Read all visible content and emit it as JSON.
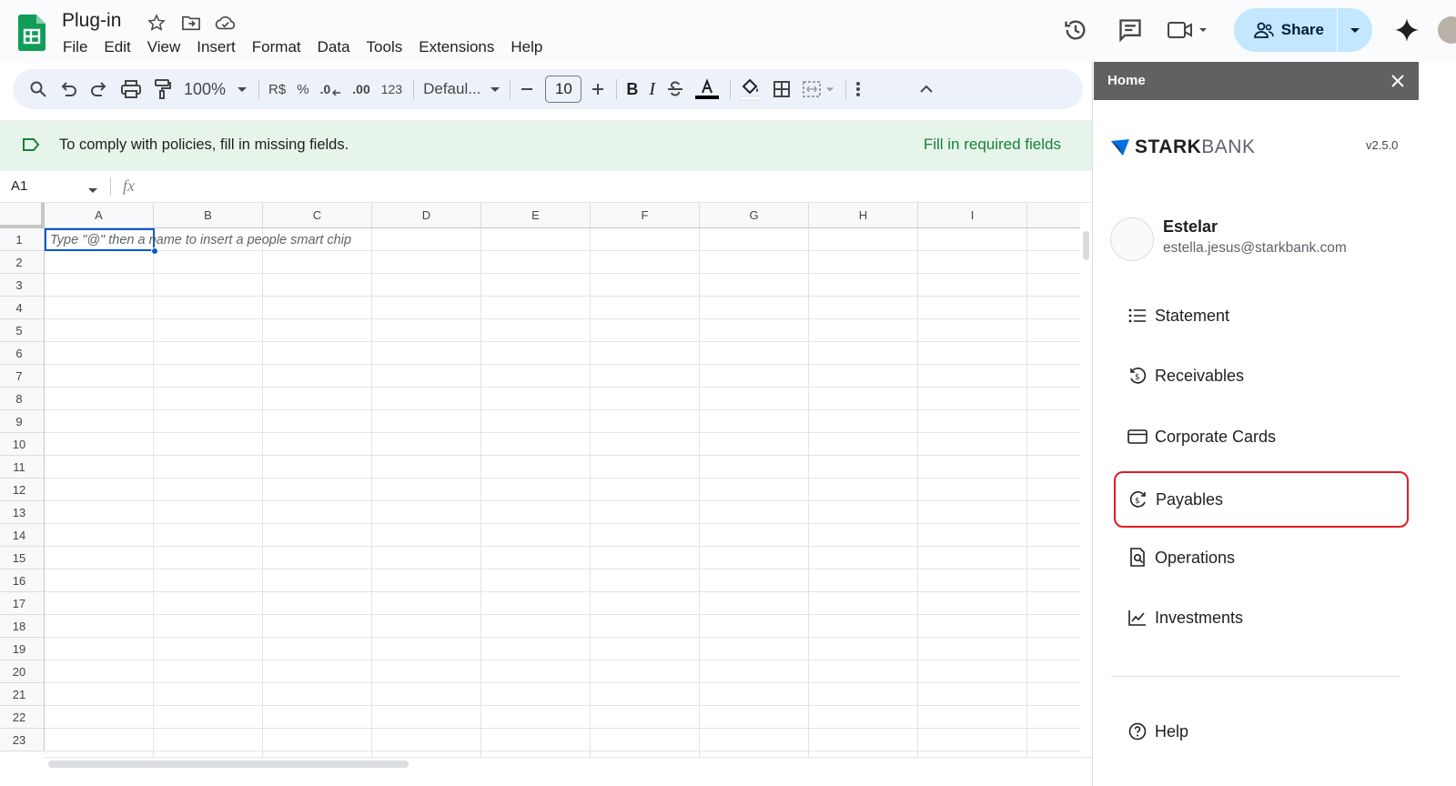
{
  "app": {
    "doc_title": "Plug-in",
    "menu": [
      "File",
      "Edit",
      "View",
      "Insert",
      "Format",
      "Data",
      "Tools",
      "Extensions",
      "Help"
    ],
    "share_label": "Share"
  },
  "toolbar": {
    "zoom": "100%",
    "currency": "R$",
    "percent": "%",
    "decrease_decimal": ".0",
    "increase_decimal": ".00",
    "number_format": "123",
    "font": "Defaul...",
    "font_size": "10",
    "bold": "B",
    "italic": "I"
  },
  "banner": {
    "message": "To comply with policies, fill in missing fields.",
    "action": "Fill in required fields"
  },
  "formula_bar": {
    "cell_ref": "A1",
    "fx": "fx"
  },
  "sheet": {
    "columns": [
      "A",
      "B",
      "C",
      "D",
      "E",
      "F",
      "G",
      "H",
      "I"
    ],
    "rows": [
      "1",
      "2",
      "3",
      "4",
      "5",
      "6",
      "7",
      "8",
      "9",
      "10",
      "11",
      "12",
      "13",
      "14",
      "15",
      "16",
      "17",
      "18",
      "19",
      "20",
      "21",
      "22",
      "23"
    ],
    "cell_hint": "Type \"@\" then a name to insert a people smart chip"
  },
  "panel": {
    "title": "Home",
    "brand_bold": "STARK",
    "brand_light": "BANK",
    "version": "v2.5.0",
    "user_name": "Estelar",
    "user_email": "estella.jesus@starkbank.com",
    "nav": [
      {
        "label": "Statement",
        "icon": "list-icon"
      },
      {
        "label": "Receivables",
        "icon": "receivable-coin-icon"
      },
      {
        "label": "Corporate Cards",
        "icon": "credit-card-icon"
      },
      {
        "label": "Payables",
        "icon": "payable-coin-icon"
      },
      {
        "label": "Operations",
        "icon": "document-search-icon"
      },
      {
        "label": "Investments",
        "icon": "trend-chart-icon"
      }
    ],
    "help_label": "Help",
    "highlight_color": "#e31b23"
  },
  "colors": {
    "brand_green": "#0f9d58",
    "share_bg": "#c2e7ff",
    "banner_bg": "#e6f4ea",
    "banner_link": "#188038",
    "selection": "#0b57d0",
    "panel_header": "#616161"
  }
}
